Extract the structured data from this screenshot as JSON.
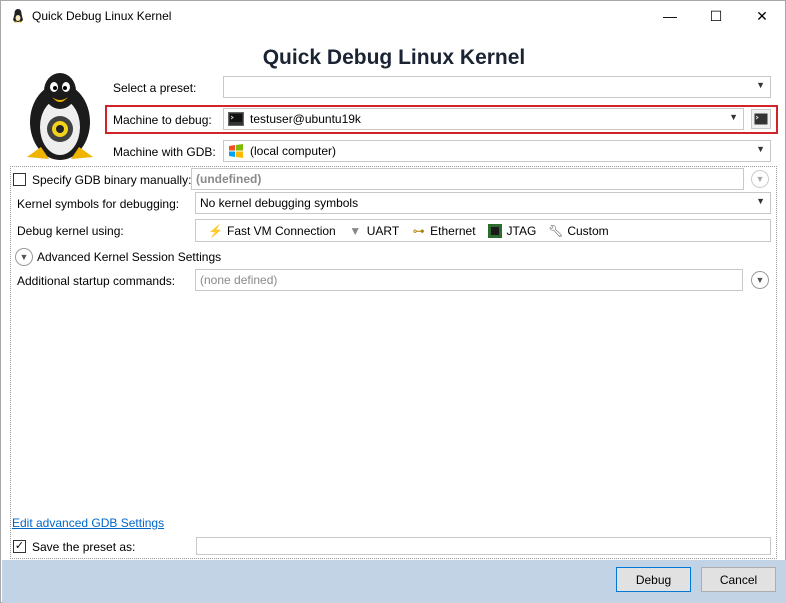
{
  "window": {
    "title": "Quick Debug Linux Kernel",
    "minimize_glyph": "—",
    "maximize_glyph": "☐",
    "close_glyph": "✕"
  },
  "heading": "Quick Debug Linux Kernel",
  "preset": {
    "label": "Select a preset:",
    "value": ""
  },
  "machine": {
    "label": "Machine to debug:",
    "value": "testuser@ubuntu19k"
  },
  "gdb_machine": {
    "label": "Machine with GDB:",
    "value": "(local computer)"
  },
  "gdb_binary": {
    "label": "Specify GDB binary manually:",
    "value": "(undefined)",
    "checked": false
  },
  "symbols": {
    "label": "Kernel symbols for debugging:",
    "value": "No kernel debugging symbols"
  },
  "debug_using": {
    "label": "Debug kernel using:",
    "options": [
      {
        "label": "Fast VM Connection",
        "icon": "lightning-icon"
      },
      {
        "label": "UART",
        "icon": "uart-icon"
      },
      {
        "label": "Ethernet",
        "icon": "ethernet-icon"
      },
      {
        "label": "JTAG",
        "icon": "chip-icon"
      },
      {
        "label": "Custom",
        "icon": "wrench-icon"
      }
    ]
  },
  "advanced_session": {
    "label": "Advanced Kernel Session Settings"
  },
  "startup": {
    "label": "Additional startup commands:",
    "value": "(none defined)"
  },
  "advanced_gdb_link": "Edit advanced GDB Settings",
  "save_preset": {
    "label": "Save the preset as:",
    "checked": true,
    "value": ""
  },
  "buttons": {
    "debug": "Debug",
    "cancel": "Cancel"
  },
  "colors": {
    "highlight": "#d1232a",
    "footer": "#c3d3e6",
    "link": "#0066cc"
  }
}
